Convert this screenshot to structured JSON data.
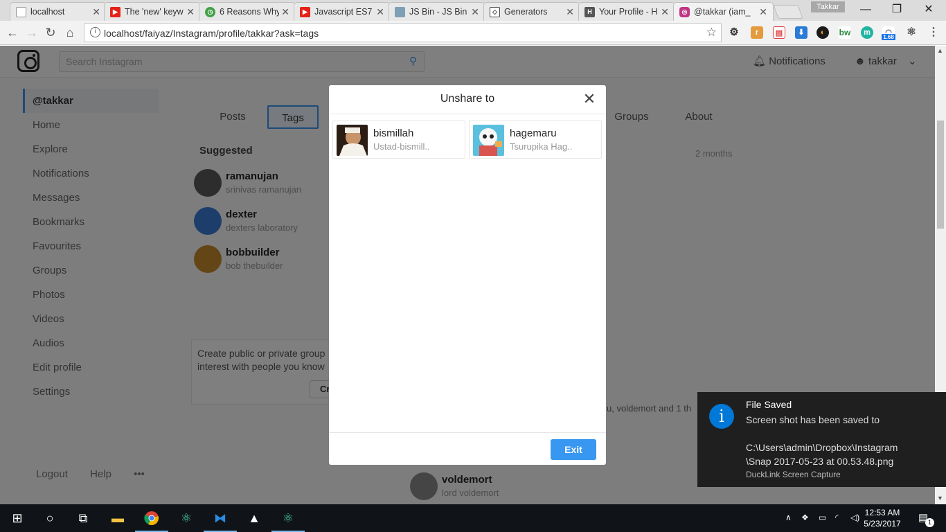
{
  "browser": {
    "tabs": [
      {
        "label": "localhost",
        "favicon": "page-icon",
        "color": "#9e9e9e"
      },
      {
        "label": "The 'new' keyw",
        "favicon": "youtube-icon",
        "color": "#e62117"
      },
      {
        "label": "6 Reasons Why",
        "favicon": "clock-icon",
        "color": "#43a047"
      },
      {
        "label": "Javascript ES7",
        "favicon": "youtube-icon",
        "color": "#e62117"
      },
      {
        "label": "JS Bin - JS Bin",
        "favicon": "jsbin-icon",
        "color": "#7e9fb6"
      },
      {
        "label": "Generators",
        "favicon": "codepen-icon",
        "color": "#444444"
      },
      {
        "label": "Your Profile - H",
        "favicon": "h-icon",
        "color": "#555555"
      },
      {
        "label": "@takkar (iam_",
        "favicon": "instagram-icon",
        "color": "#c13584"
      }
    ],
    "profile_name": "Takkar",
    "url": "localhost/faiyaz/Instagram/profile/takkar?ask=tags",
    "ext_badge": "1.68"
  },
  "instagram": {
    "search_placeholder": "Search Instagram",
    "notifications_label": "Notifications",
    "username": "takkar",
    "sidebar": [
      {
        "label": "@takkar",
        "active": true
      },
      {
        "label": "Home"
      },
      {
        "label": "Explore"
      },
      {
        "label": "Notifications"
      },
      {
        "label": "Messages"
      },
      {
        "label": "Bookmarks"
      },
      {
        "label": "Favourites"
      },
      {
        "label": "Groups"
      },
      {
        "label": "Photos"
      },
      {
        "label": "Videos"
      },
      {
        "label": "Audios"
      },
      {
        "label": "Edit profile"
      },
      {
        "label": "Settings"
      }
    ],
    "footer": {
      "logout": "Logout",
      "help": "Help",
      "more": "•••"
    },
    "profile_tabs": [
      "Posts",
      "Tags",
      "Groups",
      "About"
    ],
    "suggested_title": "Suggested",
    "suggested": [
      {
        "name": "ramanujan",
        "sub": "srinivas ramanujan"
      },
      {
        "name": "dexter",
        "sub": "dexters laboratory"
      },
      {
        "name": "bobbuilder",
        "sub": "bob thebuilder"
      }
    ],
    "group_card_text": "Create public or private group interest with people you know",
    "group_card_btn": "Cr",
    "timestamp": "2 months",
    "liked_by": "u, voldemort and 1 th",
    "bottom_user": {
      "name": "voldemort",
      "sub": "lord voldemort"
    }
  },
  "modal": {
    "title": "Unshare to",
    "users": [
      {
        "name": "bismillah",
        "sub": "Ustad-bismill.."
      },
      {
        "name": "hagemaru",
        "sub": "Tsurupika Hag.."
      }
    ],
    "exit_label": "Exit"
  },
  "toast": {
    "title": "File Saved",
    "line1": "Screen shot has been saved to",
    "path1": "C:\\Users\\admin\\Dropbox\\Instagram",
    "path2": "\\Snap 2017-05-23 at 00.53.48.png",
    "source": "DuckLink Screen Capture"
  },
  "taskbar": {
    "time": "12:53 AM",
    "date": "5/23/2017",
    "action_center_count": "1"
  },
  "colors": {
    "accent": "#3897f0",
    "toast_icon": "#0078d7"
  }
}
